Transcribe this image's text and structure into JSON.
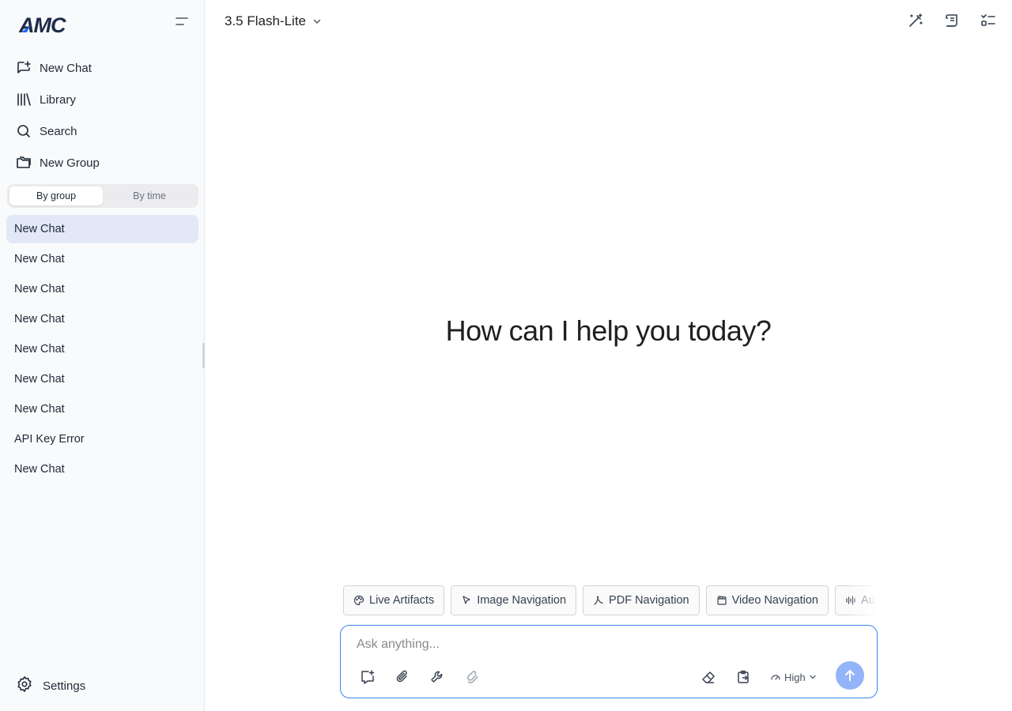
{
  "app": {
    "logo_text": "AMC"
  },
  "sidebar": {
    "nav": [
      {
        "label": "New Chat",
        "icon": "new-chat-icon"
      },
      {
        "label": "Library",
        "icon": "library-icon"
      },
      {
        "label": "Search",
        "icon": "search-icon"
      },
      {
        "label": "New Group",
        "icon": "folder-icon"
      }
    ],
    "tabs": [
      {
        "label": "By group",
        "active": true
      },
      {
        "label": "By time",
        "active": false
      }
    ],
    "chats": [
      {
        "label": "New Chat",
        "active": true
      },
      {
        "label": "New Chat"
      },
      {
        "label": "New Chat"
      },
      {
        "label": "New Chat"
      },
      {
        "label": "New Chat"
      },
      {
        "label": "New Chat"
      },
      {
        "label": "New Chat"
      },
      {
        "label": "API Key Error"
      },
      {
        "label": "New Chat"
      }
    ],
    "settings_label": "Settings"
  },
  "header": {
    "model": "3.5 Flash-Lite",
    "icons": [
      "magic-wand-icon",
      "prompt-scroll-icon",
      "task-list-icon"
    ]
  },
  "main": {
    "greeting": "How can I help you today?",
    "chips": [
      {
        "label": "Live Artifacts",
        "icon": "palette-icon"
      },
      {
        "label": "Image Navigation",
        "icon": "cursor-icon"
      },
      {
        "label": "PDF Navigation",
        "icon": "pdf-icon"
      },
      {
        "label": "Video Navigation",
        "icon": "clapperboard-icon"
      },
      {
        "label": "Au",
        "icon": "audio-wave-icon"
      }
    ]
  },
  "composer": {
    "placeholder": "Ask anything...",
    "effort": "High",
    "colors": {
      "accent": "#3b82f6",
      "send": "#93b4f8"
    }
  }
}
